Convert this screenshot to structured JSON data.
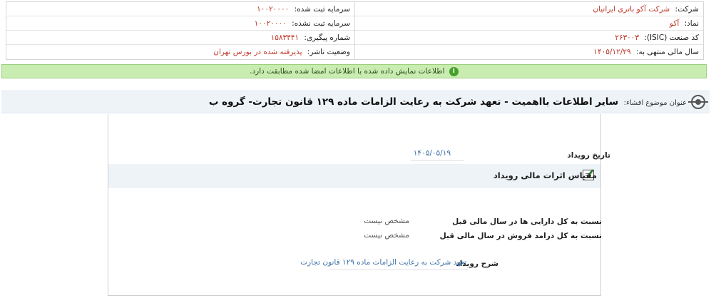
{
  "company_info": {
    "company": {
      "label": "شرکت:",
      "value": "شرکت آکو باتری ایرانیان"
    },
    "registered_capital": {
      "label": "سرمایه ثبت شده:",
      "value": "۱۰۰۲۰۰۰۰"
    },
    "symbol": {
      "label": "نماد:",
      "value": "آکو"
    },
    "unregistered_capital": {
      "label": "سرمایه ثبت نشده:",
      "value": "۱۰۰۲۰۰۰۰"
    },
    "isic": {
      "label": "کد صنعت (ISIC):",
      "value": "۲۶۳۰۰۳"
    },
    "tracking_number": {
      "label": "شماره پیگیری:",
      "value": "۱۵۸۳۴۴۱"
    },
    "fiscal_year_end": {
      "label": "سال مالی منتهی به:",
      "value": "۱۴۰۵/۱۲/۲۹"
    },
    "publisher_status": {
      "label": "وضعیت ناشر:",
      "value": "پذیرفته شده در بورس تهران"
    }
  },
  "message": {
    "text": "اطلاعات نمایش داده شده با اطلاعات امضا شده مطابقت دارد.",
    "icon": "info-icon"
  },
  "disclosure": {
    "label": "عنوان موضوع افشاء:",
    "title": "سایر اطلاعات بااهمیت - تعهد شرکت به رعایت الزامات ماده ۱۲۹ قانون تجارت- گروه ب"
  },
  "event": {
    "date_label": "تاریخ رویداد",
    "date_value": "۱۴۰۵/۰۵/۱۹",
    "section_title": "مقیاس اثرات مالی رویداد",
    "rows": [
      {
        "label": "نسبت به کل دارایی ها در سال مالی قبل",
        "value": "مشخص نیست"
      },
      {
        "label": "نسبت به کل درامد فروش در سال مالی قبل",
        "value": "مشخص نیست"
      }
    ],
    "description_label": "شرح رویداد",
    "description_value": "تعهد شرکت به رعایت الزامات ماده ۱۲۹ قانون تجارت"
  },
  "colors": {
    "accent_value": "#c0392b",
    "link": "#3b6fa8",
    "success_bg": "#c9ecb1",
    "strip_bg": "#eef3f8"
  }
}
